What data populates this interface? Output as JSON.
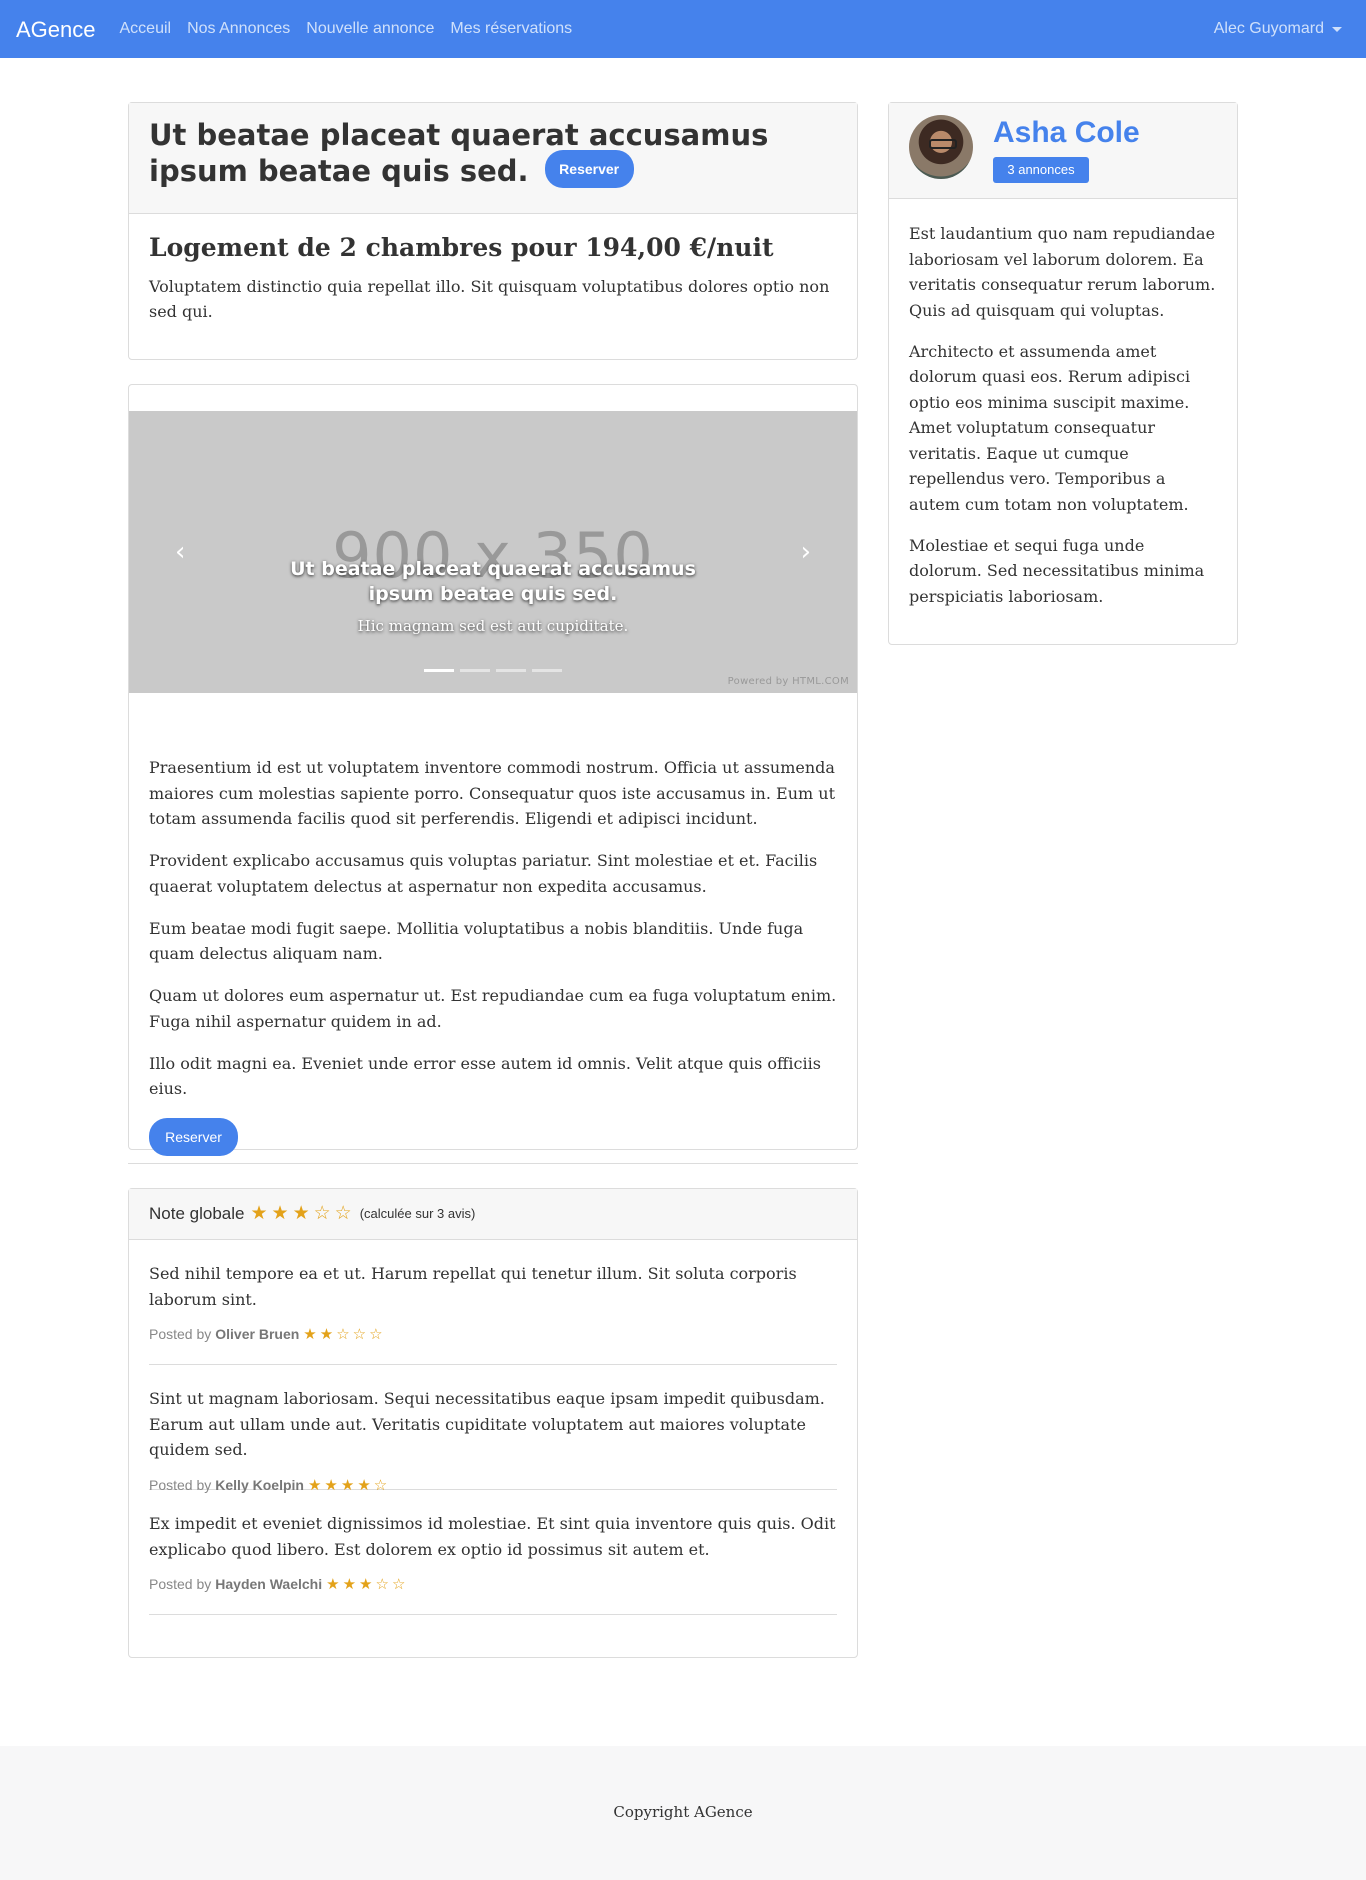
{
  "nav": {
    "brand": "AGence",
    "links": [
      "Acceuil",
      "Nos Annonces",
      "Nouvelle annonce",
      "Mes réservations"
    ],
    "user": "Alec Guyomard"
  },
  "ad": {
    "title": "Ut beatae placeat quaerat accusamus ipsum beatae quis sed.",
    "reserve_label": "Reserver",
    "price_line": "Logement de 2 chambres pour 194,00 €/nuit",
    "intro": "Voluptatem distinctio quia repellat illo. Sit quisquam voluptatibus dolores optio non sed qui."
  },
  "carousel": {
    "placeholder": "900 x 350",
    "caption_title": "Ut beatae placeat quaerat accusamus ipsum beatae quis sed.",
    "caption_sub": "Hic magnam sed est aut cupiditate.",
    "prev_icon": "‹",
    "next_icon": "›",
    "indicator_count": 4,
    "active_index": 0,
    "powered": "Powered by HTML.COM"
  },
  "content": {
    "paragraphs": [
      "Praesentium id est ut voluptatem inventore commodi nostrum. Officia ut assumenda maiores cum molestias sapiente porro. Consequatur quos iste accusamus in. Eum ut totam assumenda facilis quod sit perferendis. Eligendi et adipisci incidunt.",
      "Provident explicabo accusamus quis voluptas pariatur. Sint molestiae et et. Facilis quaerat voluptatem delectus at aspernatur non expedita accusamus.",
      "Eum beatae modi fugit saepe. Mollitia voluptatibus a nobis blanditiis. Unde fuga quam delectus aliquam nam.",
      "Quam ut dolores eum aspernatur ut. Est repudiandae cum ea fuga voluptatum enim. Fuga nihil aspernatur quidem in ad.",
      "Illo odit magni ea. Eveniet unde error esse autem id omnis. Velit atque quis officiis eius."
    ],
    "reserve_label": "Reserver"
  },
  "reviews": {
    "label": "Note globale",
    "rating": 3,
    "max": 5,
    "count_text": "(calculée sur 3 avis)",
    "posted_by": "Posted by",
    "items": [
      {
        "text": "Sed nihil tempore ea et ut. Harum repellat qui tenetur illum. Sit soluta corporis laborum sint.",
        "author": "Oliver Bruen",
        "rating": 2
      },
      {
        "text": "Sint ut magnam laboriosam. Sequi necessitatibus eaque ipsam impedit quibusdam. Earum aut ullam unde aut. Veritatis cupiditate voluptatem aut maiores voluptate quidem sed.",
        "author": "Kelly Koelpin",
        "rating": 4
      },
      {
        "text": "Ex impedit et eveniet dignissimos id molestiae. Et sint quia inventore quis quis. Odit explicabo quod libero. Est dolorem ex optio id possimus sit autem et.",
        "author": "Hayden Waelchi",
        "rating": 3
      }
    ]
  },
  "host": {
    "name": "Asha Cole",
    "badge": "3 annonces",
    "bio": [
      "Est laudantium quo nam repudiandae laboriosam vel laborum dolorem. Ea veritatis consequatur rerum laborum. Quis ad quisquam qui voluptas.",
      "Architecto et assumenda amet dolorum quasi eos. Rerum adipisci optio eos minima suscipit maxime. Amet voluptatum consequatur veritatis. Eaque ut cumque repellendus vero. Temporibus a autem cum totam non voluptatem.",
      "Molestiae et sequi fuga unde dolorum. Sed necessitatibus minima perspiciatis laboriosam."
    ]
  },
  "footer": {
    "copyright": "Copyright AGence"
  },
  "colors": {
    "primary": "#4582ec",
    "star": "#e3a21a"
  }
}
